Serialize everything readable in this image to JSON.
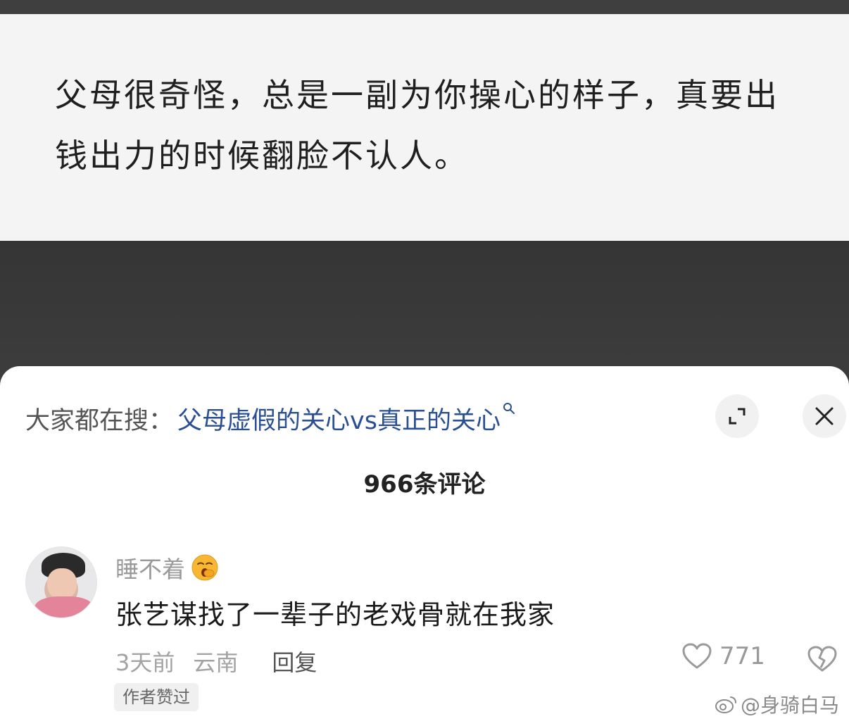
{
  "post": {
    "text": "父母很奇怪，总是一副为你操心的样子，真要出钱出力的时候翻脸不认人。"
  },
  "sheet": {
    "search_prefix": "大家都在搜：",
    "search_term": "父母虚假的关心vs真正的关心",
    "comment_count": "966条评论"
  },
  "comment": {
    "username": "睡不着",
    "text": "张艺谋找了一辈子的老戏骨就在我家",
    "time": "3天前",
    "location": "云南",
    "reply_label": "回复",
    "likes": "771",
    "badge": "作者赞过"
  },
  "watermark": {
    "text": "@身骑白马"
  },
  "colors": {
    "link": "#2b4f93",
    "muted": "#a3a3a3",
    "background_dark": "#3a3a3a"
  },
  "icons": [
    "search-icon",
    "expand-icon",
    "close-icon",
    "yawn-emoji-icon",
    "heart-icon",
    "broken-heart-icon",
    "weibo-icon"
  ]
}
